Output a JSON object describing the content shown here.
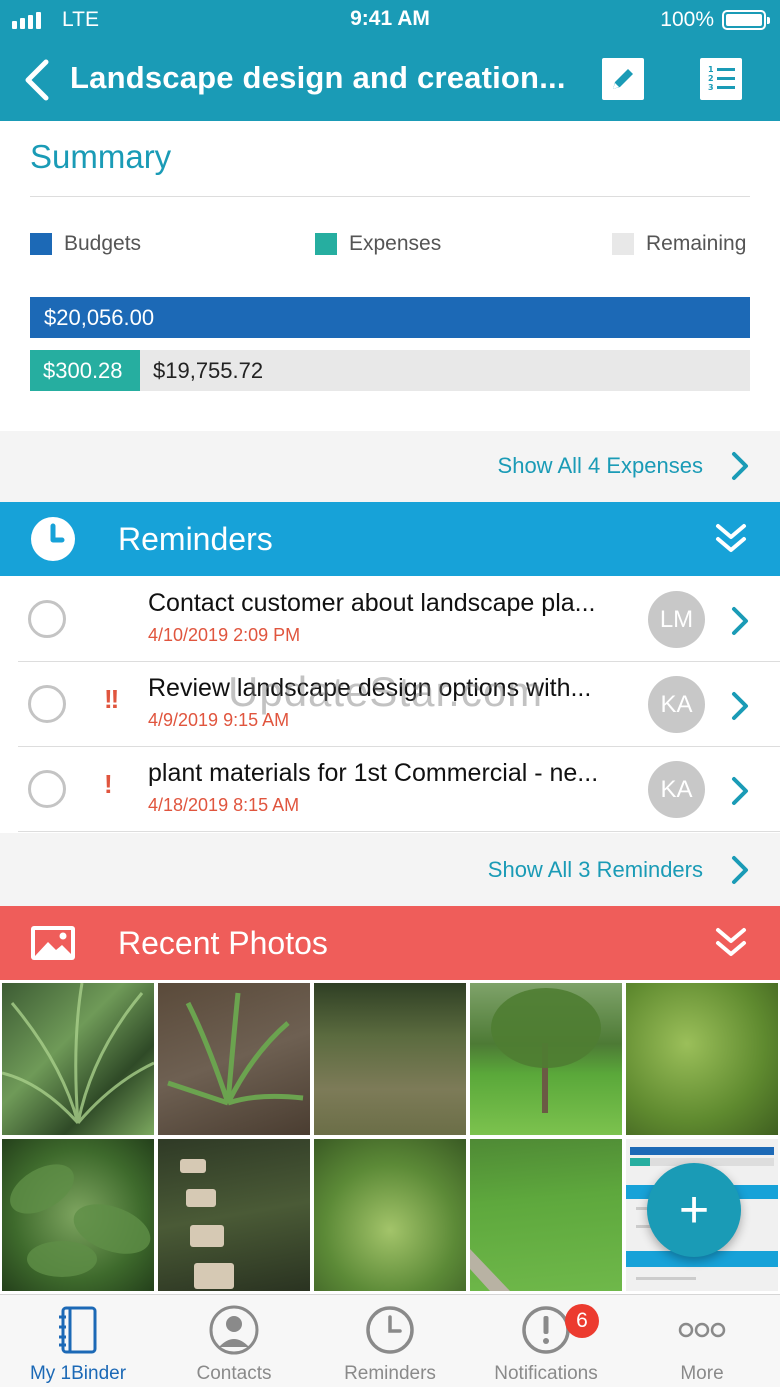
{
  "status_bar": {
    "carrier": "LTE",
    "time": "9:41 AM",
    "battery": "100%"
  },
  "nav": {
    "title": "Landscape design and creation...",
    "back_icon": "chevron-left-icon",
    "edit_icon": "pencil-icon",
    "list_icon": "numbered-list-icon"
  },
  "summary": {
    "title": "Summary",
    "legend": {
      "budgets": "Budgets",
      "expenses": "Expenses",
      "remaining": "Remaining"
    },
    "budget_amount": "$20,056.00",
    "expenses_amount": "$300.28",
    "remaining_amount": "$19,755.72",
    "expenses_fraction": 0.015,
    "colors": {
      "budgets": "#1c69b6",
      "expenses": "#26aea0",
      "remaining": "#e8e8e8"
    },
    "show_all": "Show All 4 Expenses"
  },
  "reminders": {
    "title": "Reminders",
    "header_color": "#17a2d8",
    "items": [
      {
        "text": "Contact customer about landscape pla...",
        "date": "4/10/2019 2:09 PM",
        "priority": "",
        "avatar": "LM"
      },
      {
        "text": "Review landscape design options with...",
        "date": "4/9/2019 9:15 AM",
        "priority": "!!",
        "avatar": "KA"
      },
      {
        "text": "plant materials for 1st Commercial - ne...",
        "date": "4/18/2019 8:15 AM",
        "priority": "!",
        "avatar": "KA"
      }
    ],
    "show_all": "Show All 3 Reminders"
  },
  "photos": {
    "title": "Recent Photos",
    "header_color": "#ef5d5a",
    "thumbnails": [
      "spiky-grass-plant",
      "grass-clump-mulch",
      "lawn-with-patches",
      "young-tree-on-lawn",
      "leafy-shrub",
      "philodendron-leaves",
      "stepping-stones",
      "green-shrubs",
      "grass-lawn-path",
      "app-screenshot"
    ]
  },
  "watermark": "UpdateStar.com",
  "fab_label": "+",
  "tabs": [
    {
      "label": "My 1Binder",
      "icon": "binder-icon",
      "active": true
    },
    {
      "label": "Contacts",
      "icon": "person-icon",
      "active": false
    },
    {
      "label": "Reminders",
      "icon": "clock-icon",
      "active": false
    },
    {
      "label": "Notifications",
      "icon": "alert-icon",
      "active": false,
      "badge": "6"
    },
    {
      "label": "More",
      "icon": "more-dots-icon",
      "active": false
    }
  ]
}
